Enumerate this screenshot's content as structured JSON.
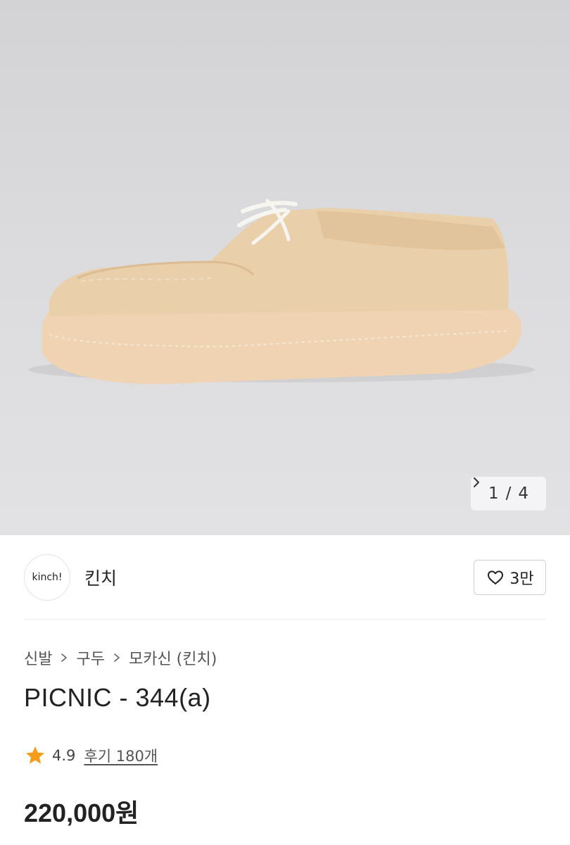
{
  "gallery": {
    "image": "product-photo-beige-suede-moccasin",
    "current": "1",
    "separator": "/",
    "total": "4",
    "next_icon": "chevron-right-icon"
  },
  "brand": {
    "logo_text": "kinch!",
    "name": "킨치",
    "likes": "3만",
    "like_icon": "heart-outline-icon"
  },
  "breadcrumb": [
    "신발",
    "구두",
    "모카신 (킨치)"
  ],
  "product": {
    "title": "PICNIC - 344(a)",
    "rating": "4.9",
    "reviews_label": "후기 180개",
    "price": "220,000원"
  },
  "colors": {
    "accent_star": "#f59c1a",
    "text": "#222222"
  }
}
